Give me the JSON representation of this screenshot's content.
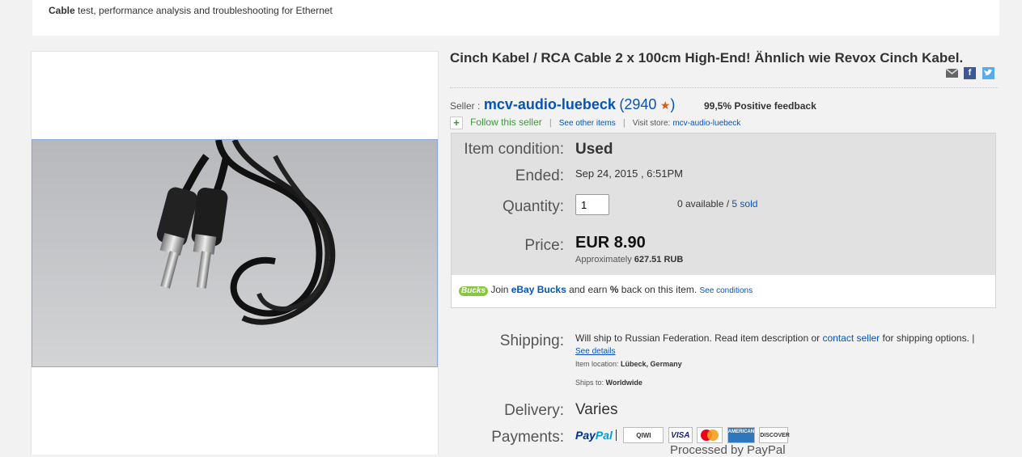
{
  "banner": {
    "bold": "Cable",
    "rest": " test, performance analysis and troubleshooting for Ethernet"
  },
  "listing": {
    "title": "Cinch Kabel / RCA Cable 2 x 100cm High-End! Ähnlich wie Revox Cinch Kabel."
  },
  "seller": {
    "label": "Seller :",
    "name": "mcv-audio-luebeck",
    "open_paren": "(",
    "score": "2940",
    "close_paren": ")",
    "feedback": "99,5% Positive feedback",
    "follow": "Follow this seller",
    "sep": "|",
    "see_other": "See other items",
    "visit_label": "Visit store:",
    "store_name": "mcv-audio-luebeck"
  },
  "details": {
    "condition_label": "Item condition:",
    "condition_value": "Used",
    "ended_label": "Ended:",
    "ended_value": "Sep 24, 2015 , 6:51PM",
    "quantity_label": "Quantity:",
    "quantity_value": "1",
    "available": "0 available / ",
    "sold": "5 sold",
    "price_label": "Price:",
    "price_value": "EUR 8.90",
    "approx_prefix": "Approximately ",
    "approx_value": "627.51 RUB"
  },
  "bucks": {
    "logo": "Bucks",
    "join": " Join ",
    "ebay_bucks": "eBay Bucks",
    "earn": " and earn ",
    "pct": "%",
    "back": " back on this item. ",
    "see_conditions": "See conditions"
  },
  "shipping": {
    "label": "Shipping:",
    "text1": "Will ship to Russian Federation. Read item description or ",
    "contact": "contact seller",
    "text2": " for shipping options. | ",
    "see_details": "See details",
    "location_label": "Item location:",
    "location_value": "Lübeck, Germany",
    "ships_to_label": "Ships to:",
    "ships_to_value": "Worldwide"
  },
  "delivery": {
    "label": "Delivery:",
    "value": "Varies"
  },
  "payments": {
    "label": "Payments:",
    "paypal_a": "Pay",
    "paypal_b": "Pal",
    "qiwi": "QIWI",
    "visa": "VISA",
    "amex": "AMERICAN EXPRESS",
    "discover": "DISCOVER",
    "processed": "Processed by PayPal"
  },
  "icons": [
    "email-icon",
    "facebook-icon",
    "twitter-icon",
    "star-icon",
    "plus-icon"
  ],
  "colors": {
    "link": "#0654ba",
    "star": "#e05a14",
    "follow": "#3a9a3a",
    "bucks": "#88c540"
  }
}
